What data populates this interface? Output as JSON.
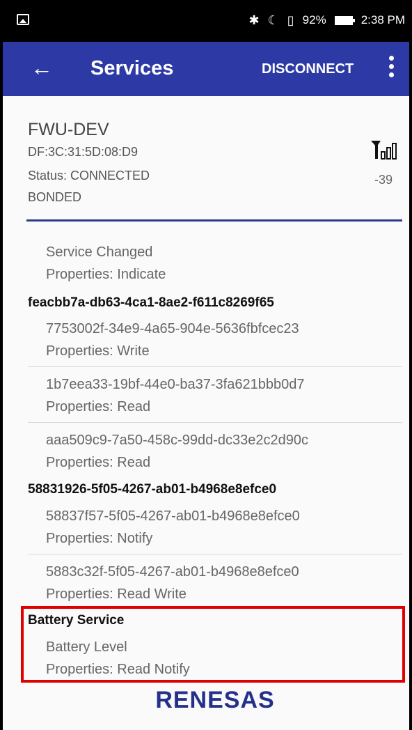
{
  "status_bar": {
    "bluetooth_icon": "bluetooth-icon",
    "alarm_icon": "alarm-icon",
    "sd_icon": "sd-card-icon",
    "battery_percent": "92%",
    "time": "2:38 PM"
  },
  "app_bar": {
    "back_icon": "←",
    "title": "Services",
    "disconnect_label": "DISCONNECT",
    "color": "#2d3aa6"
  },
  "device": {
    "name": "FWU-DEV",
    "address": "DF:3C:31:5D:08:D9",
    "status": "Status:  CONNECTED",
    "bond": "BONDED",
    "rssi": "-39"
  },
  "list": {
    "c0": {
      "name": "Service Changed",
      "props": "Properties: Indicate"
    },
    "s1": "feacbb7a-db63-4ca1-8ae2-f611c8269f65",
    "c1": {
      "name": "7753002f-34e9-4a65-904e-5636fbfcec23",
      "props": "Properties: Write"
    },
    "c2": {
      "name": "1b7eea33-19bf-44e0-ba37-3fa621bbb0d7",
      "props": "Properties: Read"
    },
    "c3": {
      "name": "aaa509c9-7a50-458c-99dd-dc33e2c2d90c",
      "props": "Properties: Read"
    },
    "s2": "58831926-5f05-4267-ab01-b4968e8efce0",
    "c4": {
      "name": "58837f57-5f05-4267-ab01-b4968e8efce0",
      "props": "Properties: Notify"
    },
    "c5": {
      "name": "5883c32f-5f05-4267-ab01-b4968e8efce0",
      "props": "Properties: Read Write"
    },
    "s3": "Battery Service",
    "c6": {
      "name": "Battery Level",
      "props": "Properties: Read Notify"
    }
  },
  "highlight_color": "#e00000",
  "logo_text": "RENESAS"
}
